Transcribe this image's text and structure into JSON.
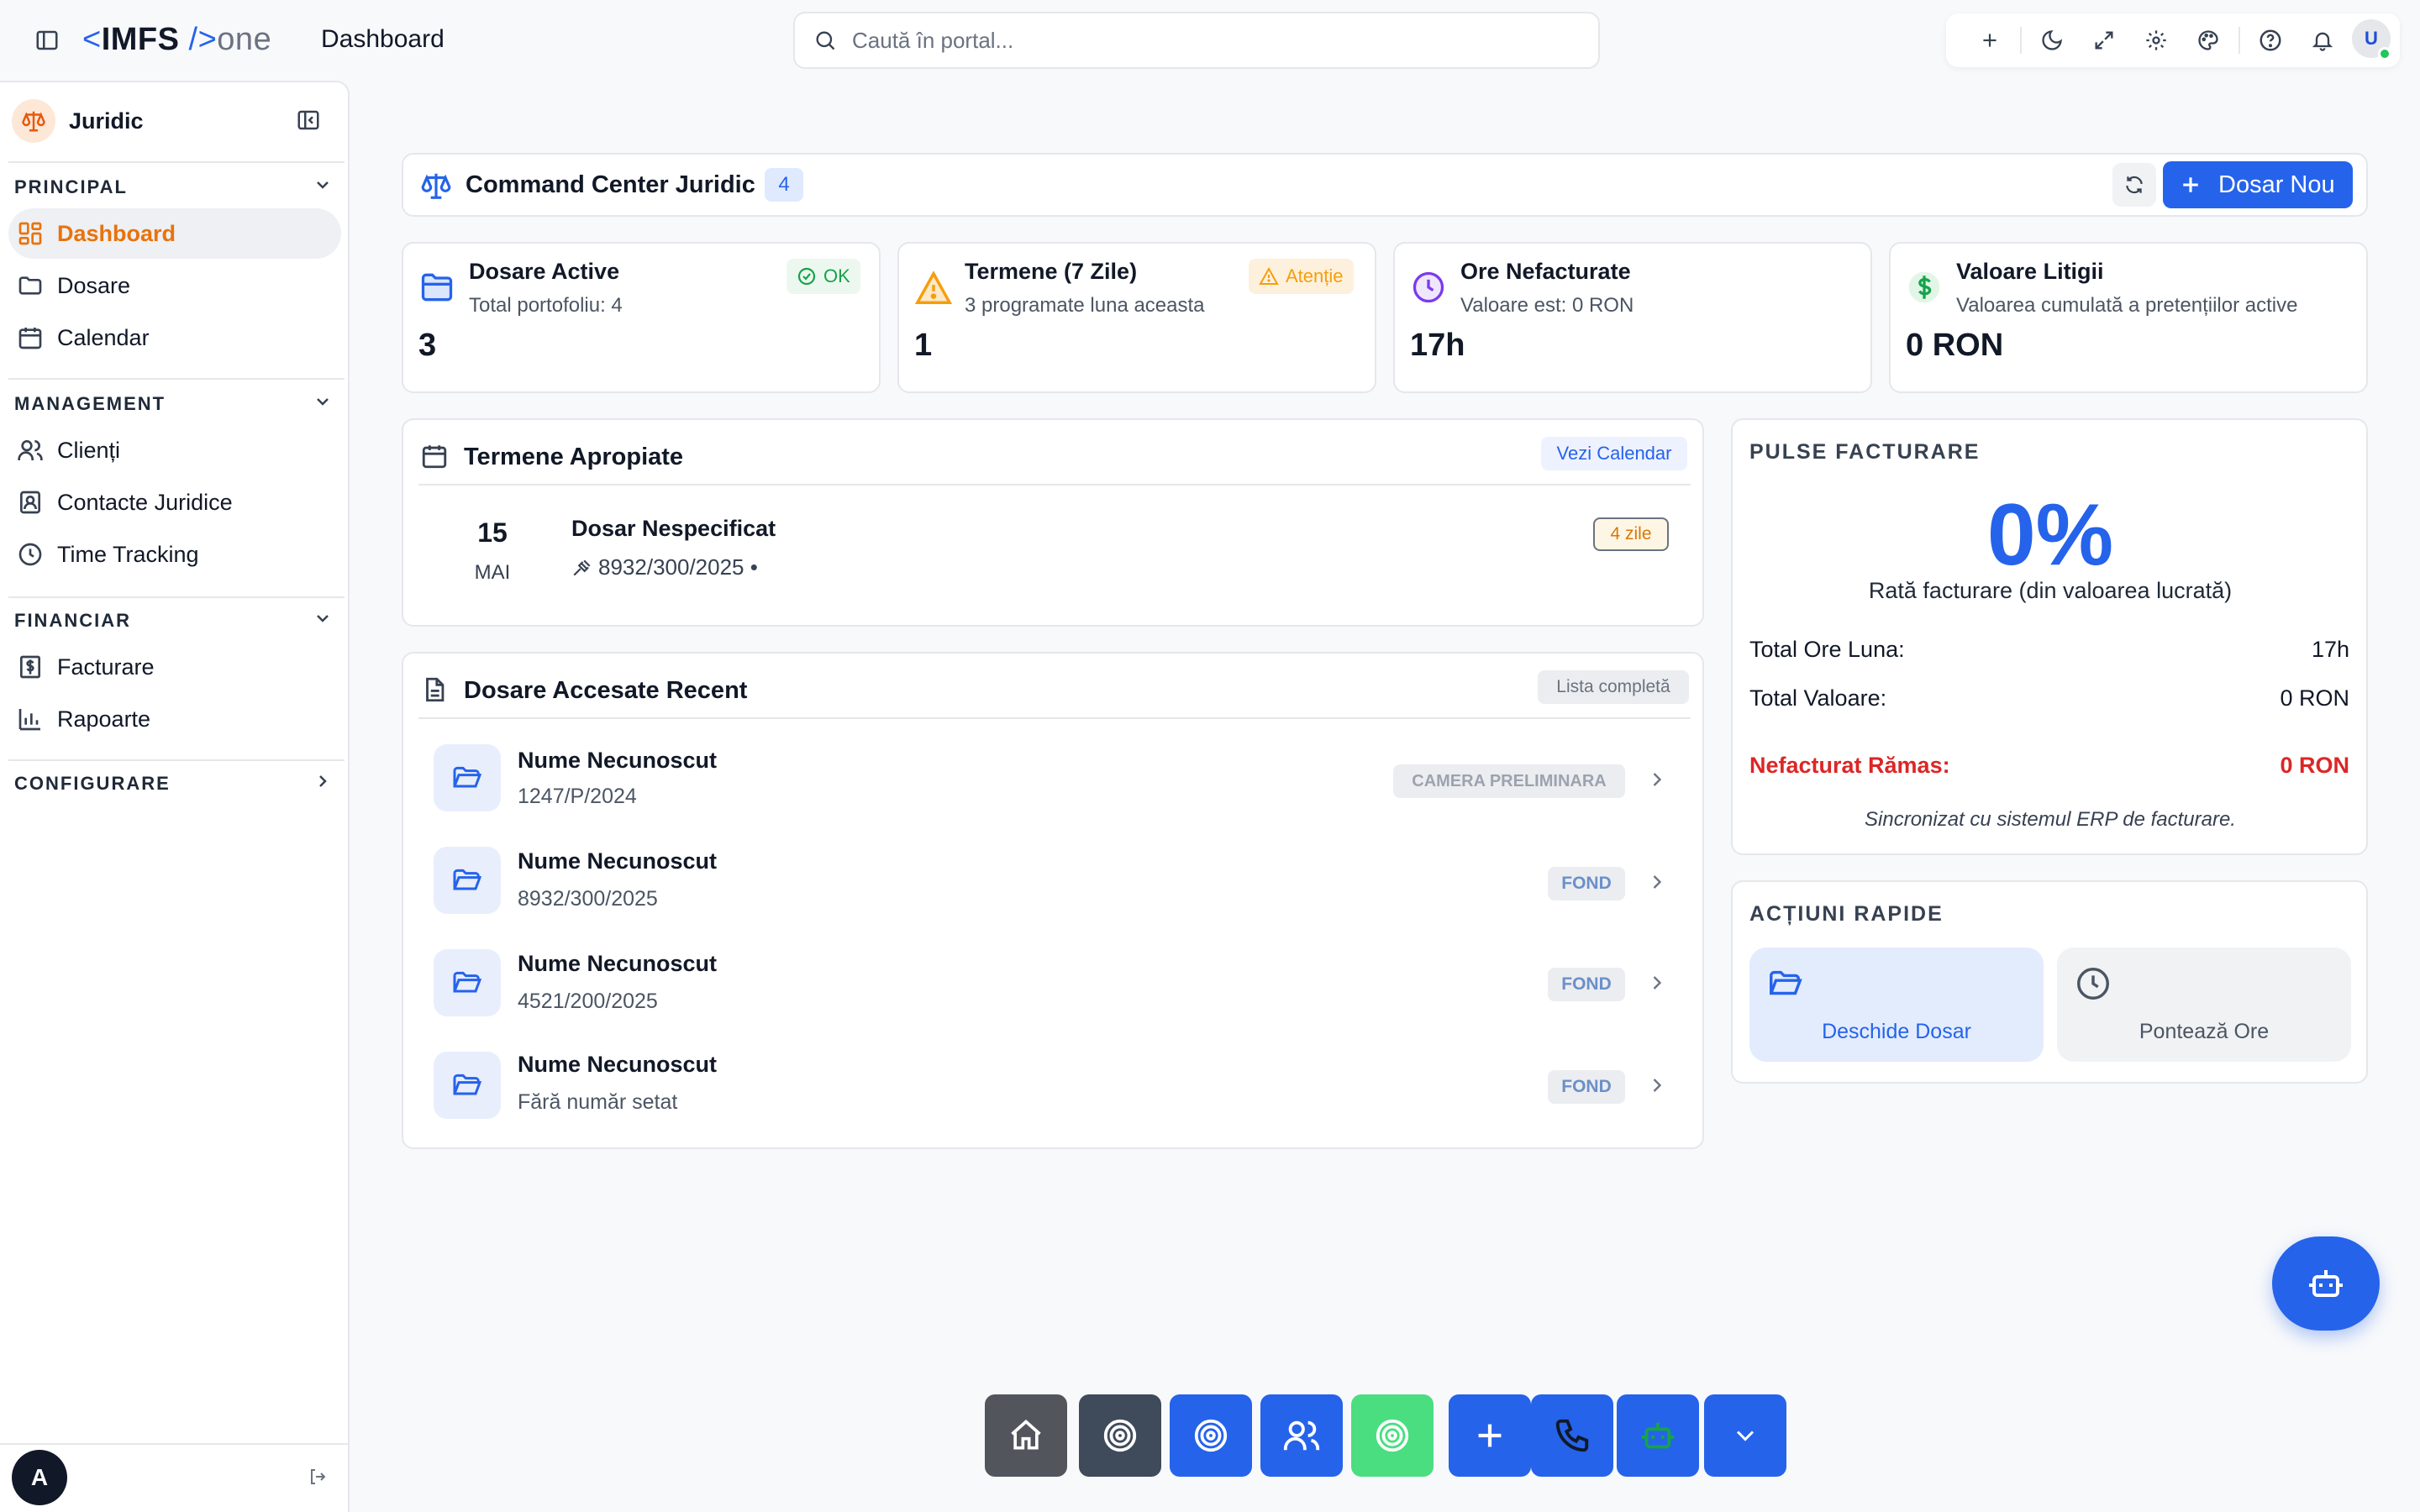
{
  "topbar": {
    "logo": {
      "bracket_left": "<",
      "brand": "IMFS",
      "slash": "/>",
      "suffix": "one"
    },
    "page_title": "Dashboard",
    "search_placeholder": "Caută în portal...",
    "user_initial": "U",
    "icons": [
      "sidebar-toggle-icon",
      "plus-icon",
      "moon-icon",
      "expand-icon",
      "gear-icon",
      "palette-icon",
      "help-icon",
      "bell-icon"
    ]
  },
  "sidebar": {
    "title": "Juridic",
    "sections": [
      {
        "label": "PRINCIPAL",
        "items": [
          {
            "label": "Dashboard",
            "icon": "dashboard-icon",
            "active": true
          },
          {
            "label": "Dosare",
            "icon": "folder-icon"
          },
          {
            "label": "Calendar",
            "icon": "calendar-icon"
          }
        ]
      },
      {
        "label": "MANAGEMENT",
        "items": [
          {
            "label": "Clienți",
            "icon": "users-icon"
          },
          {
            "label": "Contacte Juridice",
            "icon": "contact-icon"
          },
          {
            "label": "Time Tracking",
            "icon": "clock-icon"
          }
        ]
      },
      {
        "label": "FINANCIAR",
        "items": [
          {
            "label": "Facturare",
            "icon": "invoice-icon"
          },
          {
            "label": "Rapoarte",
            "icon": "chart-icon"
          }
        ]
      },
      {
        "label": "CONFIGURARE",
        "items": []
      }
    ],
    "footer_avatar": "A"
  },
  "command_center": {
    "title": "Command Center Juridic",
    "count": "4",
    "new_button": "Dosar Nou"
  },
  "stats": [
    {
      "title": "Dosare Active",
      "subtitle": "Total portofoliu: 4",
      "value": "3",
      "badge": "OK"
    },
    {
      "title": "Termene (7 Zile)",
      "subtitle": "3 programate luna aceasta",
      "value": "1",
      "badge": "Atenție"
    },
    {
      "title": "Ore Nefacturate",
      "subtitle": "Valoare est: 0 RON",
      "value": "17h"
    },
    {
      "title": "Valoare Litigii",
      "subtitle": "Valoarea cumulată a pretențiilor active",
      "value": "0 RON"
    }
  ],
  "deadlines": {
    "title": "Termene Apropiate",
    "action": "Vezi Calendar",
    "items": [
      {
        "day": "15",
        "month": "MAI",
        "name": "Dosar Nespecificat",
        "number": "8932/300/2025 •",
        "due": "4 zile"
      }
    ]
  },
  "recent": {
    "title": "Dosare Accesate Recent",
    "action": "Lista completă",
    "items": [
      {
        "name": "Nume Necunoscut",
        "number": "1247/P/2024",
        "stage": "CAMERA PRELIMINARA"
      },
      {
        "name": "Nume Necunoscut",
        "number": "8932/300/2025",
        "stage": "FOND"
      },
      {
        "name": "Nume Necunoscut",
        "number": "4521/200/2025",
        "stage": "FOND"
      },
      {
        "name": "Nume Necunoscut",
        "number": "Fără număr setat",
        "stage": "FOND"
      }
    ]
  },
  "pulse": {
    "label": "PULSE FACTURARE",
    "value": "0%",
    "description": "Rată facturare (din valoarea lucrată)",
    "rows": [
      {
        "label": "Total Ore Luna:",
        "value": "17h"
      },
      {
        "label": "Total Valoare:",
        "value": "0 RON"
      },
      {
        "label": "Nefacturat Rămas:",
        "value": "0 RON"
      }
    ],
    "footer": "Sincronizat cu sistemul ERP de facturare."
  },
  "quick_actions": {
    "label": "ACȚIUNI RAPIDE",
    "items": [
      {
        "label": "Deschide Dosar",
        "icon": "folder-open-icon"
      },
      {
        "label": "Pontează Ore",
        "icon": "clock-icon"
      }
    ]
  },
  "colors": {
    "accent": "#2563eb",
    "active_nav": "#e8730c",
    "danger": "#dc2626",
    "ok": "#16a34a",
    "warning": "#f59e0b"
  }
}
